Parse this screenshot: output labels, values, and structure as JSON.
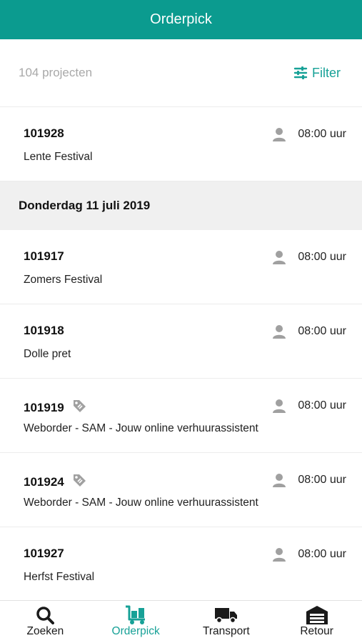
{
  "header": {
    "title": "Orderpick"
  },
  "toolbar": {
    "count_label": "104 projecten",
    "filter_label": "Filter"
  },
  "list": {
    "first_item": {
      "number": "101928",
      "name": "Lente Festival",
      "time": "08:00 uur",
      "tagged": false
    },
    "section_title": "Donderdag 11 juli 2019",
    "items": [
      {
        "number": "101917",
        "name": "Zomers Festival",
        "time": "08:00 uur",
        "tagged": false
      },
      {
        "number": "101918",
        "name": "Dolle pret",
        "time": "08:00 uur",
        "tagged": false
      },
      {
        "number": "101919",
        "name": "Weborder - SAM - Jouw online verhuurassistent",
        "time": "08:00 uur",
        "tagged": true
      },
      {
        "number": "101924",
        "name": "Weborder - SAM - Jouw online verhuurassistent",
        "time": "08:00 uur",
        "tagged": true
      },
      {
        "number": "101927",
        "name": "Herfst Festival",
        "time": "08:00 uur",
        "tagged": false
      }
    ]
  },
  "tabbar": {
    "tabs": [
      {
        "label": "Zoeken",
        "icon": "search-icon",
        "active": false
      },
      {
        "label": "Orderpick",
        "icon": "cart-icon",
        "active": true
      },
      {
        "label": "Transport",
        "icon": "truck-icon",
        "active": false
      },
      {
        "label": "Retour",
        "icon": "garage-icon",
        "active": false
      }
    ]
  },
  "colors": {
    "primary": "#0b9b8f",
    "accent": "#17a197",
    "icon_gray": "#a0a0a0",
    "section_bg": "#f0f0f0"
  }
}
